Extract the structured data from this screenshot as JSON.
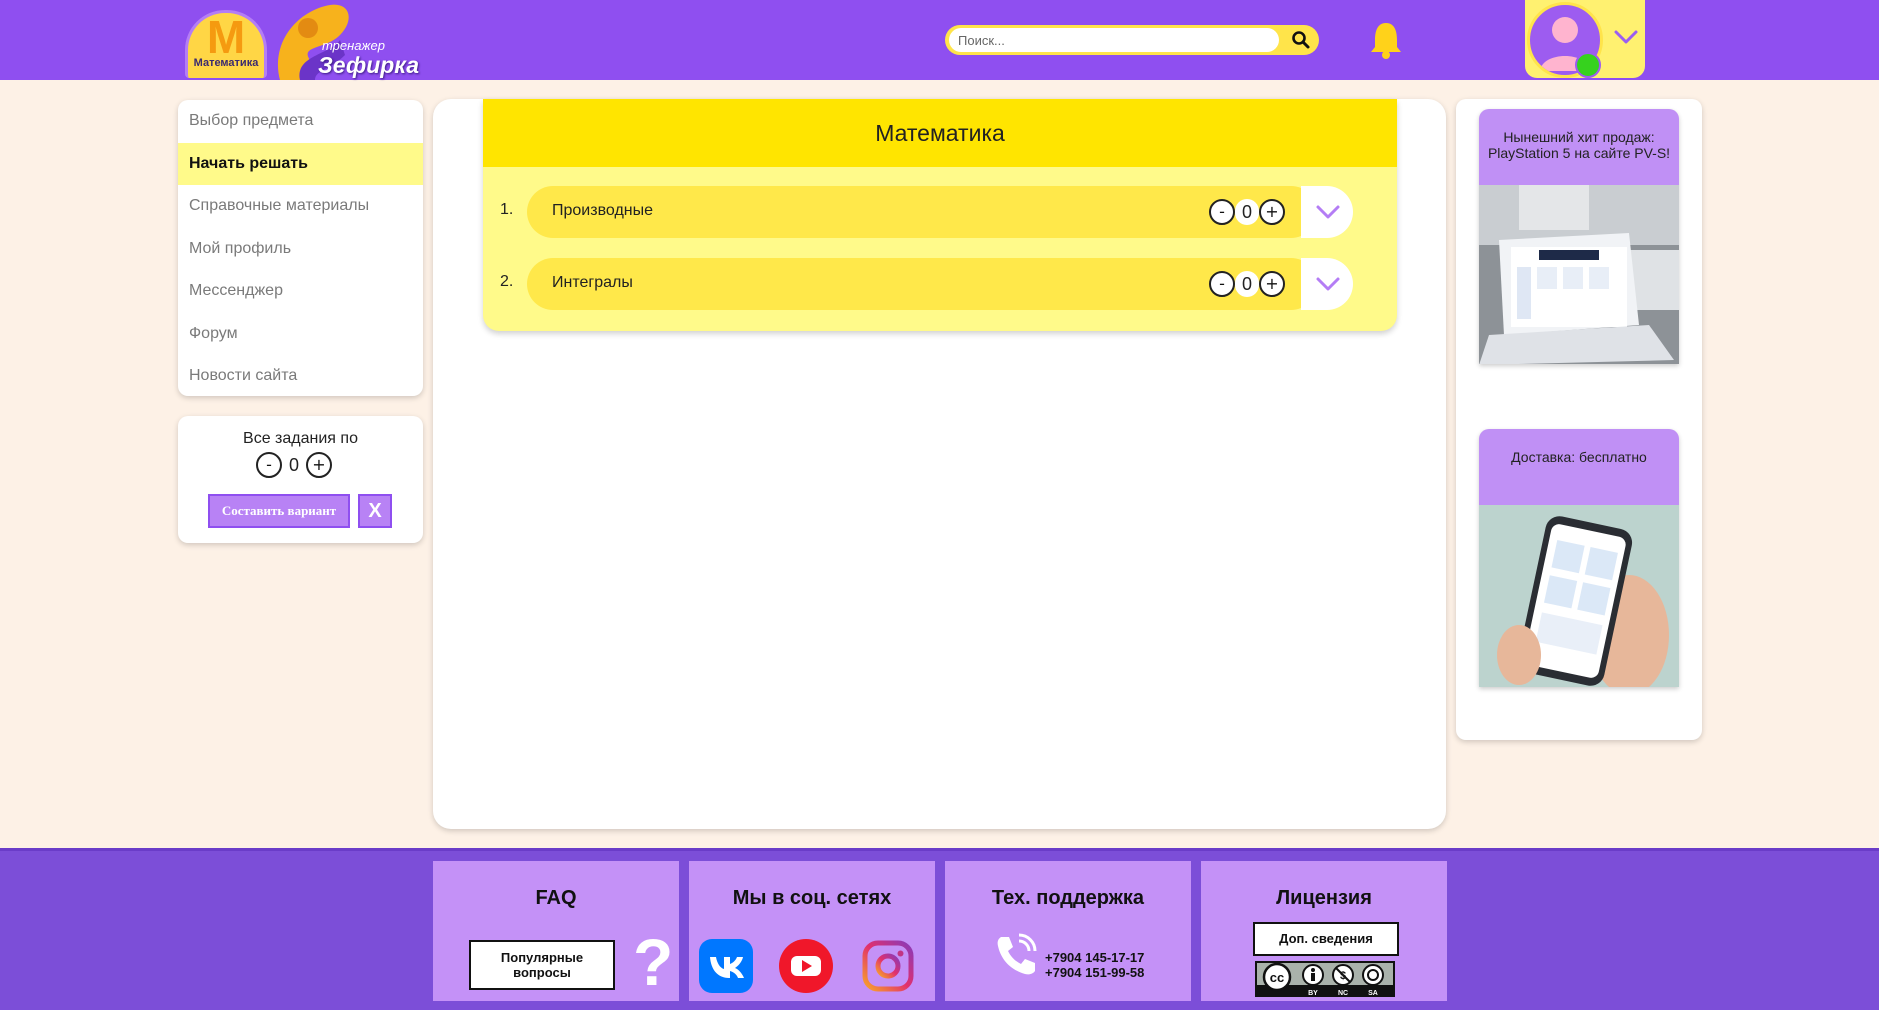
{
  "header": {
    "logo_letter": "М",
    "logo_subject": "Математика",
    "logo_trainer": "тренажер",
    "logo_name": "Зефирка",
    "search_placeholder": "Поиск...",
    "colors": {
      "bar": "#8f4ff0",
      "accent": "#ffe44a"
    }
  },
  "sidebar": {
    "items": [
      {
        "label": "Выбор предмета"
      },
      {
        "label": "Начать решать"
      },
      {
        "label": "Справочные материалы"
      },
      {
        "label": "Мой профиль"
      },
      {
        "label": "Мессенджер"
      },
      {
        "label": "Форум"
      },
      {
        "label": "Новости сайта"
      }
    ],
    "active_index": 1,
    "variant": {
      "title": "Все задания по",
      "minus": "-",
      "count": "0",
      "plus": "+",
      "compose_label": "Составить вариант",
      "clear_label": "X"
    }
  },
  "main": {
    "subject_title": "Математика",
    "topics": [
      {
        "num": "1.",
        "name": "Производные",
        "minus": "-",
        "count": "0",
        "plus": "+"
      },
      {
        "num": "2.",
        "name": "Интегралы",
        "minus": "-",
        "count": "0",
        "plus": "+"
      }
    ]
  },
  "ads": [
    {
      "text": "Нынешний хит продаж: PlayStation 5 на сайте PV-S!"
    },
    {
      "text": "Доставка: бесплатно"
    }
  ],
  "footer": {
    "faq": {
      "title": "FAQ",
      "button": "Популярные вопросы",
      "icon": "question-icon"
    },
    "social": {
      "title": "Мы в соц. сетях",
      "icons": [
        "vk-icon",
        "youtube-icon",
        "instagram-icon"
      ]
    },
    "support": {
      "title": "Тех. поддержка",
      "phone1": "+7904 145-17-17",
      "phone2": "+7904 151-99-58"
    },
    "license": {
      "title": "Лицензия",
      "button": "Доп. сведения",
      "badge_labels": [
        "BY",
        "NC",
        "SA"
      ]
    }
  }
}
